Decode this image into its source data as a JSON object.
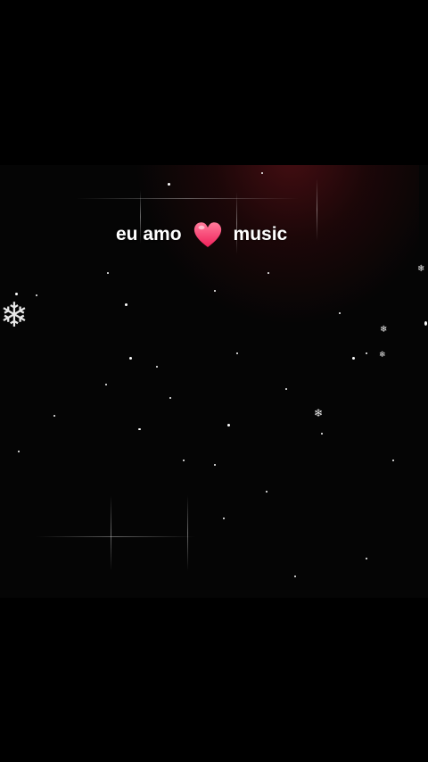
{
  "caption": {
    "text_before": "eu amo",
    "emoji": "heart-emoji",
    "text_after": "music"
  },
  "colors": {
    "background": "#000000",
    "glow": "#78141c",
    "heart": "#ff3a6e",
    "text": "#ffffff"
  }
}
